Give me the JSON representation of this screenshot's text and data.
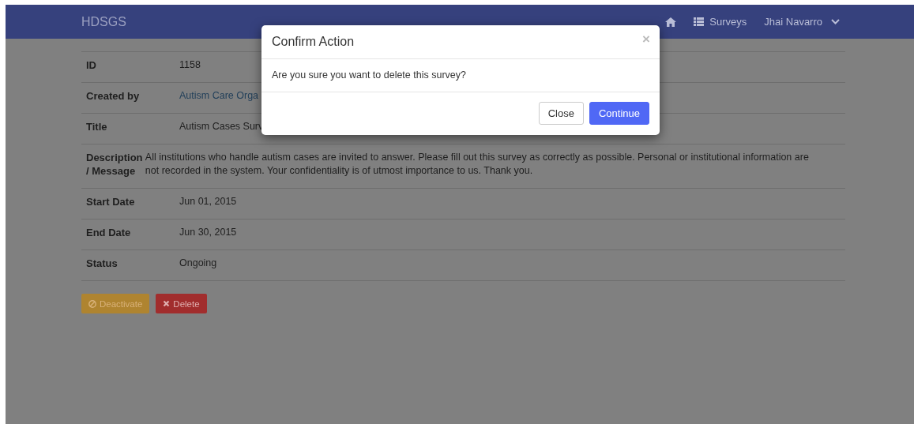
{
  "navbar": {
    "brand": "HDSGS",
    "links": [
      {
        "kind": "home"
      },
      {
        "kind": "list",
        "label": "Surveys"
      },
      {
        "kind": "dropdown",
        "label": "Jhai Navarro"
      }
    ]
  },
  "details": [
    {
      "label": "ID",
      "value": "1158",
      "kind": "text"
    },
    {
      "label": "Created by",
      "value": "Autism Care Orga",
      "kind": "link"
    },
    {
      "label": "Title",
      "value": "Autism Cases Surv",
      "kind": "text"
    },
    {
      "label": "Description / Message",
      "value": "All institutions who handle autism cases are invited to answer. Please fill out this survey as correctly as possible. Personal or institutional information are not recorded in the system. Your confidentiality is of utmost importance to us. Thank you.",
      "kind": "text"
    },
    {
      "label": "Start Date",
      "value": "Jun 01, 2015",
      "kind": "text"
    },
    {
      "label": "End Date",
      "value": "Jun 30, 2015",
      "kind": "text"
    },
    {
      "label": "Status",
      "value": "Ongoing",
      "kind": "text"
    }
  ],
  "actions": [
    {
      "kind": "warning",
      "label": "Deactivate"
    },
    {
      "kind": "danger",
      "label": "Delete"
    }
  ],
  "modal": {
    "title": "Confirm Action",
    "close_glyph": "×",
    "message": "Are you sure you want to delete this survey?",
    "buttons": [
      {
        "kind": "default",
        "label": "Close"
      },
      {
        "kind": "primary",
        "label": "Continue"
      }
    ]
  }
}
